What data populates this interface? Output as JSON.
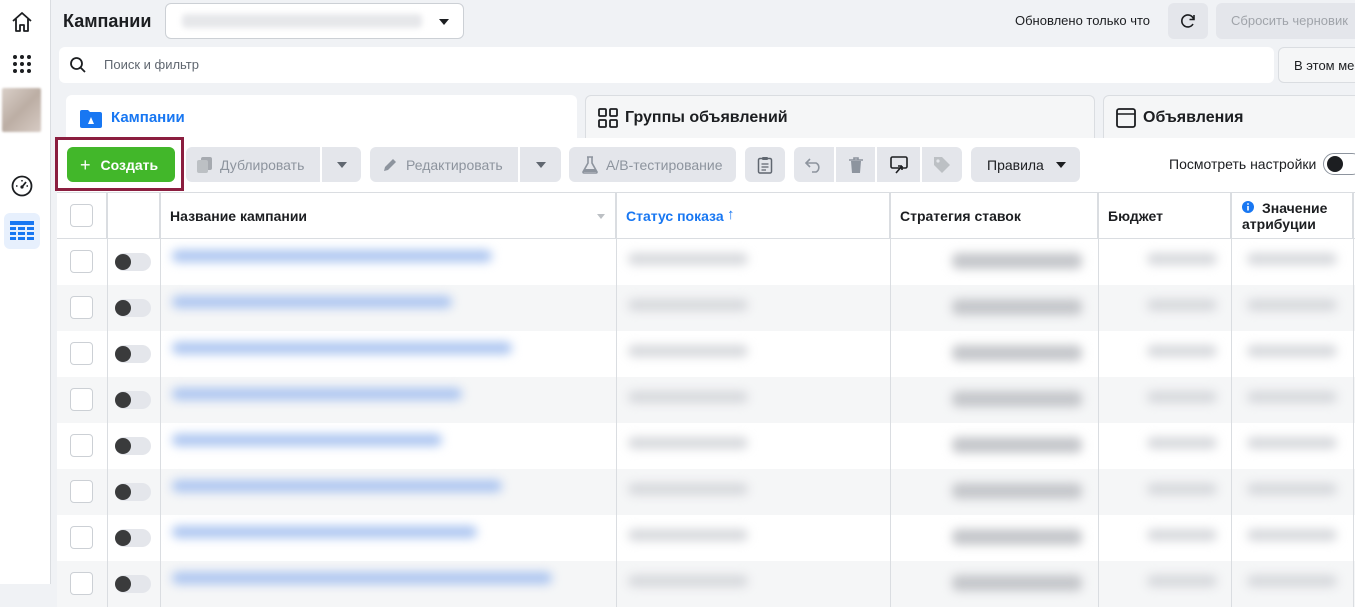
{
  "header": {
    "title": "Кампании",
    "updated_text": "Обновлено только что",
    "discard_label": "Сбросить черновик"
  },
  "search": {
    "placeholder": "Поиск и фильтр",
    "period_label": "В этом месяце"
  },
  "tabs": [
    {
      "label": "Кампании",
      "icon": "folder-icon",
      "active": true
    },
    {
      "label": "Группы объявлений",
      "icon": "grid-icon",
      "active": false
    },
    {
      "label": "Объявления",
      "icon": "ad-icon",
      "active": false
    }
  ],
  "toolbar": {
    "create_label": "Создать",
    "duplicate_label": "Дублировать",
    "edit_label": "Редактировать",
    "ab_label": "A/B-тестирование",
    "rules_label": "Правила",
    "view_settings_label": "Посмотреть настройки"
  },
  "table": {
    "columns": [
      "Название кампании",
      "Статус показа",
      "Стратегия ставок",
      "Бюджет",
      "Значение атрибуции"
    ],
    "sort_column": "Статус показа",
    "row_count": 8
  },
  "colors": {
    "accent": "#1877f2",
    "create": "#42b72a",
    "highlight": "#8b1e3f"
  }
}
